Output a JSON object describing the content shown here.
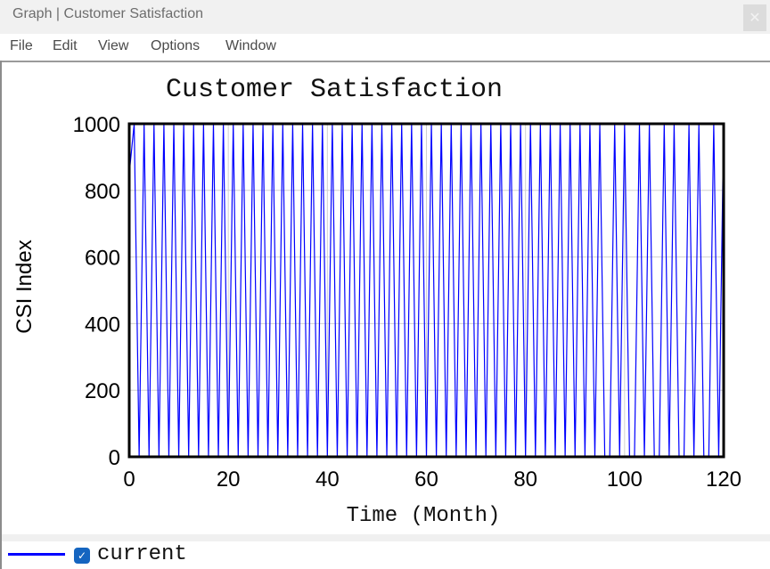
{
  "window": {
    "title": "Graph | Customer Satisfaction",
    "close_icon": "close-icon"
  },
  "menu": {
    "items": [
      "File",
      "Edit",
      "View",
      "Options",
      "Window"
    ]
  },
  "legend": {
    "items": [
      {
        "label": "current",
        "checked": true,
        "color": "#0000ff"
      }
    ]
  },
  "chart_data": {
    "type": "line",
    "title": "Customer Satisfaction",
    "xlabel": "Time (Month)",
    "ylabel": "CSI Index",
    "xlim": [
      0,
      120
    ],
    "ylim": [
      0,
      1000
    ],
    "xticks": [
      0,
      20,
      40,
      60,
      80,
      100,
      120
    ],
    "yticks": [
      0,
      200,
      400,
      600,
      800,
      1000
    ],
    "grid": true,
    "legend_position": "bottom-left",
    "series": [
      {
        "name": "current",
        "color": "#0000ff",
        "x": [
          0,
          1,
          2,
          3,
          4,
          5,
          6,
          7,
          8,
          9,
          10,
          11,
          12,
          13,
          14,
          15,
          16,
          17,
          18,
          19,
          20,
          21,
          22,
          23,
          24,
          25,
          26,
          27,
          28,
          29,
          30,
          31,
          32,
          33,
          34,
          35,
          36,
          37,
          38,
          39,
          40,
          41,
          42,
          43,
          44,
          45,
          46,
          47,
          48,
          49,
          50,
          51,
          52,
          53,
          54,
          55,
          56,
          57,
          58,
          59,
          60,
          61,
          62,
          63,
          64,
          65,
          66,
          67,
          68,
          69,
          70,
          71,
          72,
          73,
          74,
          75,
          76,
          77,
          78,
          79,
          80,
          81,
          82,
          83,
          84,
          85,
          86,
          87,
          88,
          89,
          90,
          91,
          92,
          93,
          94,
          95,
          96,
          97,
          98,
          99,
          100,
          101,
          102,
          103,
          104,
          105,
          106,
          107,
          108,
          109,
          110,
          111,
          112,
          113,
          114,
          115,
          116,
          117,
          118,
          119,
          120
        ],
        "values": [
          850,
          1000,
          0,
          1000,
          0,
          1000,
          0,
          1000,
          0,
          1000,
          0,
          1000,
          0,
          1000,
          0,
          1000,
          0,
          1000,
          0,
          1000,
          0,
          1000,
          0,
          1000,
          0,
          1000,
          0,
          1000,
          0,
          1000,
          0,
          1000,
          0,
          1000,
          0,
          1000,
          0,
          1000,
          0,
          1000,
          0,
          1000,
          0,
          1000,
          0,
          1000,
          0,
          1000,
          0,
          1000,
          0,
          1000,
          0,
          1000,
          0,
          1000,
          0,
          1000,
          0,
          1000,
          0,
          1000,
          0,
          1000,
          0,
          1000,
          0,
          1000,
          0,
          1000,
          0,
          1000,
          0,
          1000,
          0,
          1000,
          0,
          1000,
          0,
          1000,
          0,
          1000,
          0,
          1000,
          0,
          1000,
          0,
          1000,
          0,
          1000,
          0,
          1000,
          0,
          1000,
          0,
          1000,
          0,
          0,
          1000,
          0,
          1000,
          0,
          0,
          1000,
          0,
          1000,
          0,
          0,
          1000,
          0,
          1000,
          0,
          0,
          1000,
          0,
          1000,
          0,
          0,
          1000,
          0,
          1000
        ]
      }
    ]
  }
}
